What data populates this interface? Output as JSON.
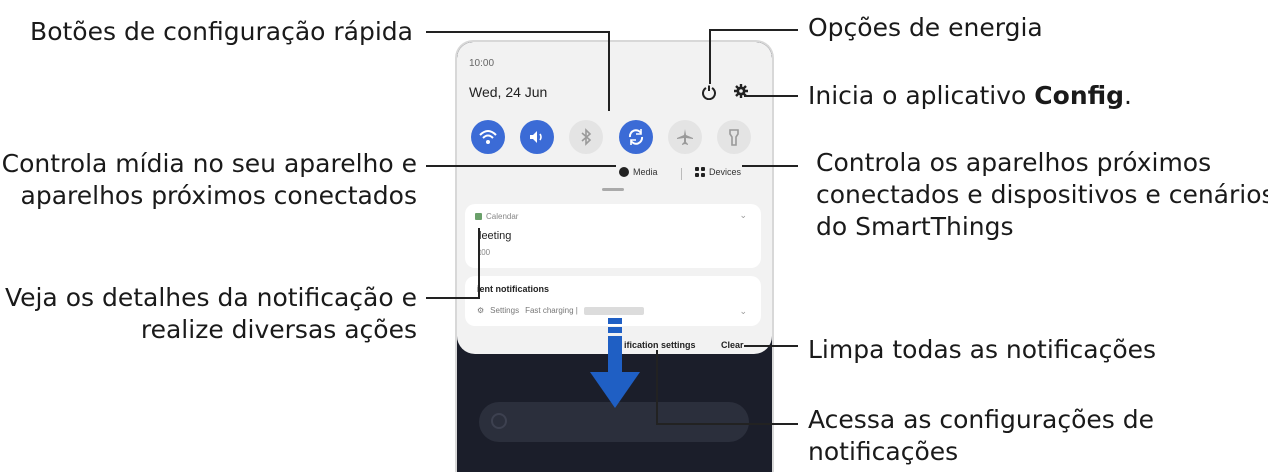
{
  "callouts": {
    "quick_settings": "Botões de configuração rápida",
    "power": "Opções de energia",
    "settings_prefix": "Inicia o aplicativo ",
    "settings_bold": "Config",
    "settings_suffix": ".",
    "media_line1": "Controla mídia no seu aparelho e",
    "media_line2": "aparelhos próximos conectados",
    "devices_line1": "Controla os aparelhos próximos",
    "devices_line2": "conectados e dispositivos e cenários",
    "devices_line3": "do SmartThings",
    "details_line1": "Veja os detalhes da notificação e",
    "details_line2": "realize diversas ações",
    "clear": "Limpa todas as notificações",
    "notif_settings_line1": "Acessa as configurações de",
    "notif_settings_line2": "notificações"
  },
  "phone": {
    "status_time": "10:00",
    "date": "Wed, 24 Jun",
    "quick_buttons": [
      {
        "icon": "wifi-icon",
        "state": "on"
      },
      {
        "icon": "sound-icon",
        "state": "on"
      },
      {
        "icon": "bluetooth-icon",
        "state": "off"
      },
      {
        "icon": "auto-rotate-icon",
        "state": "on"
      },
      {
        "icon": "airplane-icon",
        "state": "off"
      },
      {
        "icon": "flashlight-icon",
        "state": "off"
      }
    ],
    "media_label": "Media",
    "devices_label": "Devices",
    "card1": {
      "app": "Calendar",
      "title": "leeting",
      "subtitle": "t00"
    },
    "card2": {
      "title": "ient notifications",
      "app": "Settings",
      "text": "Fast charging |"
    },
    "notification_settings_label": "ification settings",
    "clear_label": "Clear"
  },
  "colors": {
    "accent": "#3b6bd6",
    "arrow": "#1f5fc4"
  }
}
